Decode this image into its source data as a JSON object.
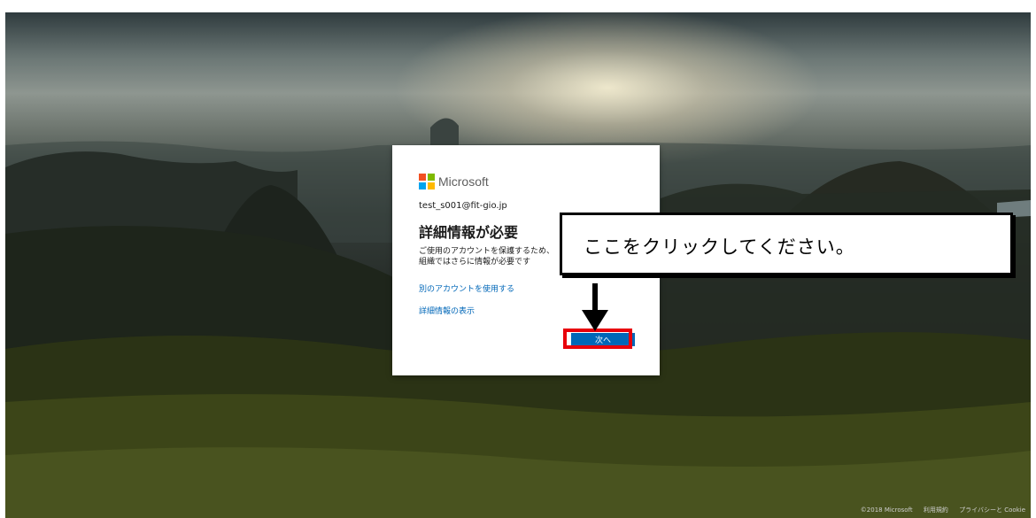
{
  "login": {
    "brand": "Microsoft",
    "email": "test_s001@fit-gio.jp",
    "title": "詳細情報が必要",
    "description": "ご使用のアカウントを保護するため、組織ではさらに情報が必要です",
    "link_other_account": "別のアカウントを使用する",
    "link_show_details": "詳細情報の表示",
    "next_button": "次へ"
  },
  "annotation": {
    "callout_text": "ここをクリックしてください。",
    "highlight_color": "#e8000b",
    "arrow_direction": "down"
  },
  "footer": {
    "copyright": "©2018 Microsoft",
    "terms": "利用規約",
    "privacy": "プライバシーと Cookie"
  },
  "colors": {
    "accent": "#0067b8",
    "logo_red": "#f25022",
    "logo_green": "#7fba00",
    "logo_blue": "#00a4ef",
    "logo_yellow": "#ffb900"
  }
}
